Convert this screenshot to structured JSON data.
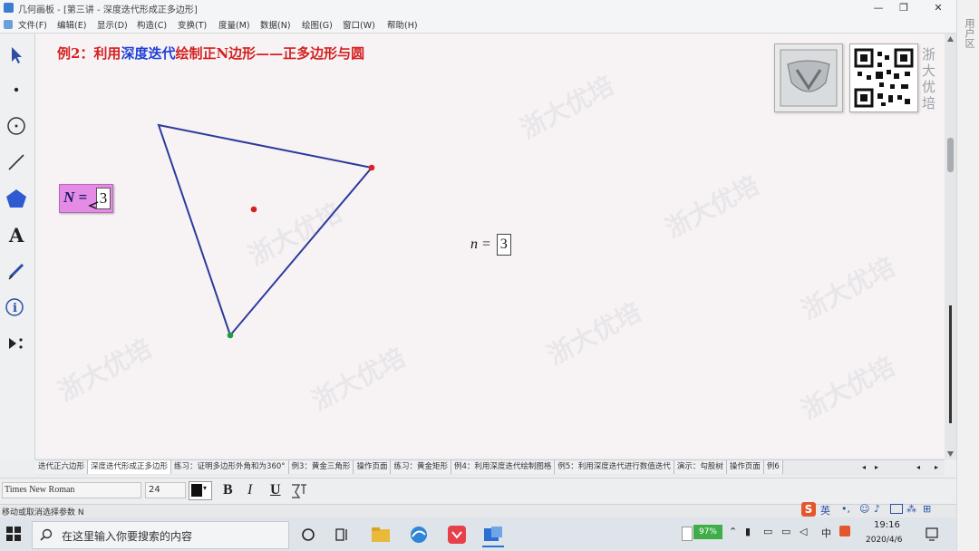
{
  "window": {
    "title": "几何画板 - [第三讲 - 深度迭代形成正多边形]",
    "controls": [
      "—",
      "❐",
      "✕"
    ]
  },
  "menu": [
    "文件(F)",
    "编辑(E)",
    "显示(D)",
    "构造(C)",
    "变换(T)",
    "度量(M)",
    "数据(N)",
    "绘图(G)",
    "窗口(W)",
    "帮助(H)"
  ],
  "canvas": {
    "heading_prefix": "例2：利用",
    "heading_highlight": "深度迭代",
    "heading_suffix": "绘制正N边形——正多边形与圆",
    "param_label": "N =",
    "param_value": "3",
    "n_label": "n =",
    "n_value": "3",
    "logo_text": "浙大优培",
    "watermark": "浙大优培"
  },
  "tabs": [
    "迭代正六边形",
    "深度迭代形成正多边形",
    "练习：证明多边形外角和为360°",
    "例3：黄金三角形",
    "操作页面",
    "练习：黄金矩形",
    "例4：利用深度迭代绘制图格",
    "例5：利用深度迭代进行数值迭代",
    "演示：勾股树",
    "操作页面",
    "例6"
  ],
  "format": {
    "font": "Times New Roman",
    "size": "24",
    "bold": "B",
    "italic": "I",
    "underline": "U"
  },
  "status": "移动或取消选择参数 N",
  "side_panel_label": "用户区",
  "taskbar": {
    "search_placeholder": "在这里输入你要搜索的内容",
    "battery": "97%",
    "ime": "英",
    "time": "19:16",
    "date": "2020/4/6"
  },
  "colors": {
    "heading_red": "#d42121",
    "heading_blue": "#1f3fd6",
    "polygon_blue": "#2b3b9c",
    "param_bg": "#e58be6"
  }
}
